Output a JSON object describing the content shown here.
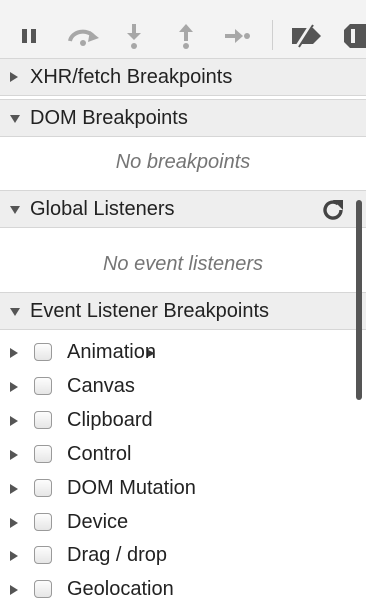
{
  "toolbar": {
    "buttons": [
      {
        "name": "pause-icon"
      },
      {
        "name": "step-over-icon"
      },
      {
        "name": "step-into-icon"
      },
      {
        "name": "step-out-icon"
      },
      {
        "name": "step-icon"
      },
      {
        "name": "deactivate-breakpoints-icon"
      },
      {
        "name": "pause-on-exceptions-icon"
      }
    ]
  },
  "sections": {
    "xhr": {
      "title": "XHR/fetch Breakpoints",
      "expanded": false
    },
    "dom": {
      "title": "DOM Breakpoints",
      "expanded": true,
      "empty": "No breakpoints"
    },
    "global": {
      "title": "Global Listeners",
      "expanded": true,
      "empty": "No event listeners"
    },
    "event": {
      "title": "Event Listener Breakpoints",
      "expanded": true
    }
  },
  "event_listeners": [
    {
      "label": "Animation",
      "checked": false
    },
    {
      "label": "Canvas",
      "checked": false
    },
    {
      "label": "Clipboard",
      "checked": false
    },
    {
      "label": "Control",
      "checked": false
    },
    {
      "label": "DOM Mutation",
      "checked": false
    },
    {
      "label": "Device",
      "checked": false
    },
    {
      "label": "Drag / drop",
      "checked": false
    },
    {
      "label": "Geolocation",
      "checked": false
    }
  ],
  "colors": {
    "icon_disabled": "#a7a7a7",
    "icon_active": "#555555",
    "header_bg": "#eeeeee"
  }
}
